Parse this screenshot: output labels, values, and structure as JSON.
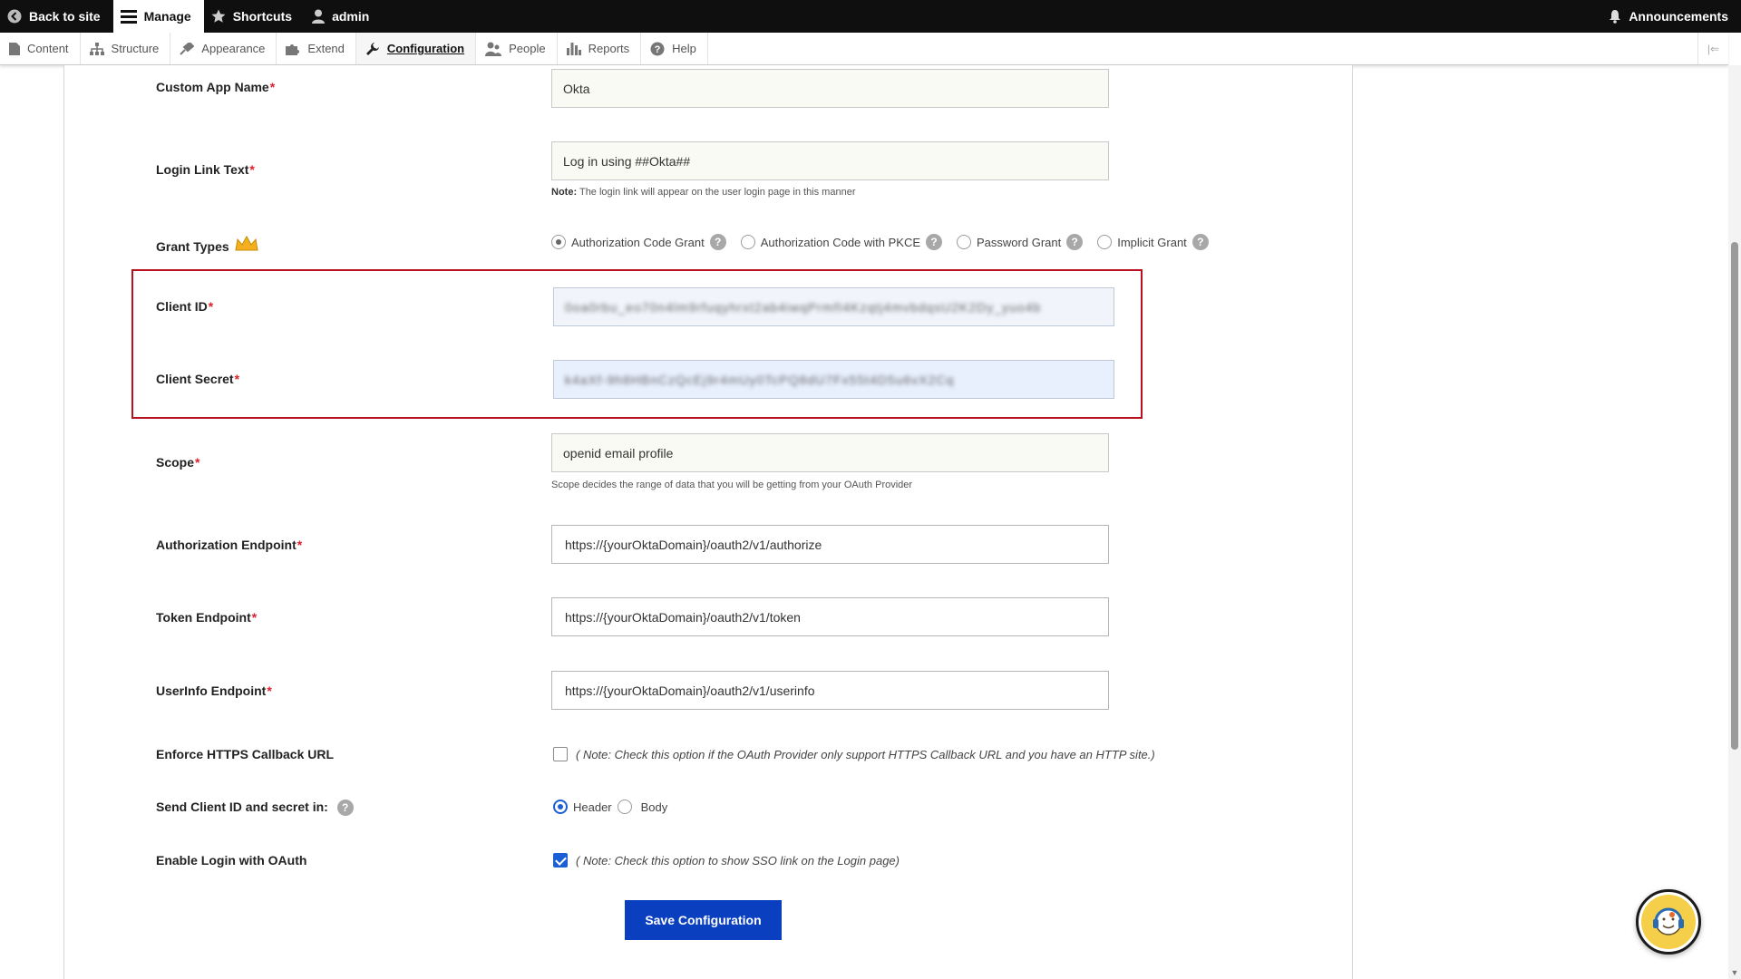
{
  "toolbar": {
    "back": "Back to site",
    "manage": "Manage",
    "shortcuts": "Shortcuts",
    "user": "admin",
    "announcements": "Announcements"
  },
  "tray": {
    "items": [
      "Content",
      "Structure",
      "Appearance",
      "Extend",
      "Configuration",
      "People",
      "Reports",
      "Help"
    ],
    "active": "Configuration"
  },
  "form": {
    "custom_app_name": {
      "label": "Custom App Name",
      "value": "Okta"
    },
    "login_link_text": {
      "label": "Login Link Text",
      "value": "Log in using ##Okta##",
      "note_prefix": "Note:",
      "note": "The login link will appear on the user login page in this manner"
    },
    "grant_types": {
      "label": "Grant Types",
      "options": [
        "Authorization Code Grant",
        "Authorization Code with PKCE",
        "Password Grant",
        "Implicit Grant"
      ],
      "selected": "Authorization Code Grant"
    },
    "client_id": {
      "label": "Client ID",
      "value": "0oa0rbu_eo70n4lm9rfuqyhrxt2ab4iwqPrmfI4Kzqtj4mvbdqsU2K2Dy_yuo4b"
    },
    "client_secret": {
      "label": "Client Secret",
      "value": "k4aXf-9h8HBnCzQcEj9r4mUy0TcPQ8dU7Fx55t4D5u6vX2Cq"
    },
    "scope": {
      "label": "Scope",
      "value": "openid email profile",
      "note": "Scope decides the range of data that you will be getting from your OAuth Provider"
    },
    "authorization_endpoint": {
      "label": "Authorization Endpoint",
      "value": "https://{yourOktaDomain}/oauth2/v1/authorize"
    },
    "token_endpoint": {
      "label": "Token Endpoint",
      "value": "https://{yourOktaDomain}/oauth2/v1/token"
    },
    "userinfo_endpoint": {
      "label": "UserInfo Endpoint",
      "value": "https://{yourOktaDomain}/oauth2/v1/userinfo"
    },
    "enforce_https": {
      "label": "Enforce HTTPS Callback URL",
      "checked": false,
      "note": "( Note: Check this option if the OAuth Provider only support HTTPS Callback URL and you have an HTTP site.)"
    },
    "send_client": {
      "label": "Send Client ID and secret in:",
      "options": [
        "Header",
        "Body"
      ],
      "selected": "Header"
    },
    "enable_login": {
      "label": "Enable Login with OAuth",
      "checked": true,
      "note": "( Note: Check this option to show SSO link on the Login page)"
    },
    "save_label": "Save Configuration",
    "required_mark": "*",
    "help_mark": "?"
  },
  "colors": {
    "primary": "#0a3fc0",
    "required": "#e11d2a",
    "highlight": "#b9101f",
    "toolbar": "#0f0f0f"
  }
}
